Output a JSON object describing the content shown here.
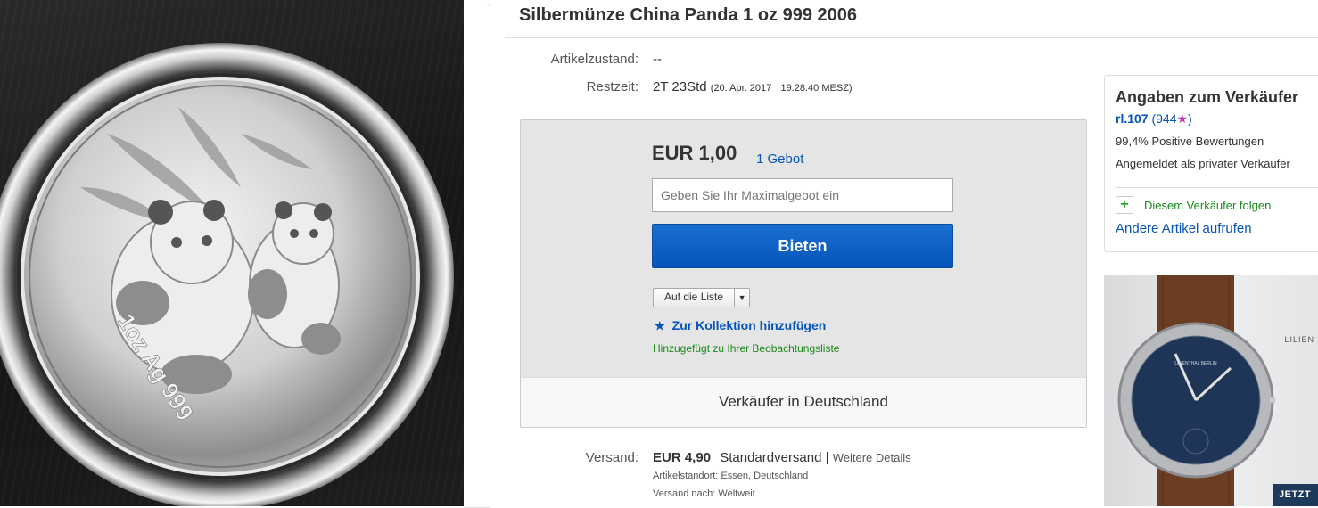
{
  "product": {
    "title": "Silbermünze China Panda 1 oz 999 2006",
    "image_text": {
      "line1": "1oz Ag 999"
    }
  },
  "details": {
    "condition_label": "Artikelzustand:",
    "condition_value": "--",
    "time_left_label": "Restzeit:",
    "time_left_value": "2T 23Std",
    "end_date": "(20. Apr. 2017",
    "end_time": "19:28:40 MESZ)"
  },
  "bid": {
    "price": "EUR 1,00",
    "bid_count": "1 Gebot",
    "input_placeholder": "Geben Sie Ihr Maximalgebot ein",
    "button_label": "Bieten",
    "watchlist_label": "Auf die Liste",
    "collection_label": "Zur Kollektion hinzufügen",
    "watched_notice": "Hinzugefügt zu Ihrer Beobachtungsliste",
    "seller_location": "Verkäufer in Deutschland"
  },
  "shipping": {
    "label": "Versand:",
    "price": "EUR 4,90",
    "method": "Standardversand |",
    "details_link": "Weitere Details",
    "item_location_label": "Artikelstandort:",
    "item_location": "Essen, Deutschland",
    "ships_to_label": "Versand nach:",
    "ships_to": "Weltweit"
  },
  "seller": {
    "heading": "Angaben zum Verkäufer",
    "name": "rl.107",
    "feedback_score": "(944",
    "feedback_close": ")",
    "positive": "99,4% Positive Bewertungen",
    "account_type": "Angemeldet als privater Verkäufer",
    "follow_label": "Diesem Verkäufer folgen",
    "other_items": "Andere Artikel aufrufen"
  },
  "ad": {
    "brand": "LILIEN",
    "dial_brand": "LILIENTHAL BERLIN",
    "cta": "JETZT"
  },
  "colors": {
    "link": "#0654ba",
    "bid_button": "#0654ba",
    "success_green": "#1a8a19",
    "star_purple": "#c13ab8"
  }
}
